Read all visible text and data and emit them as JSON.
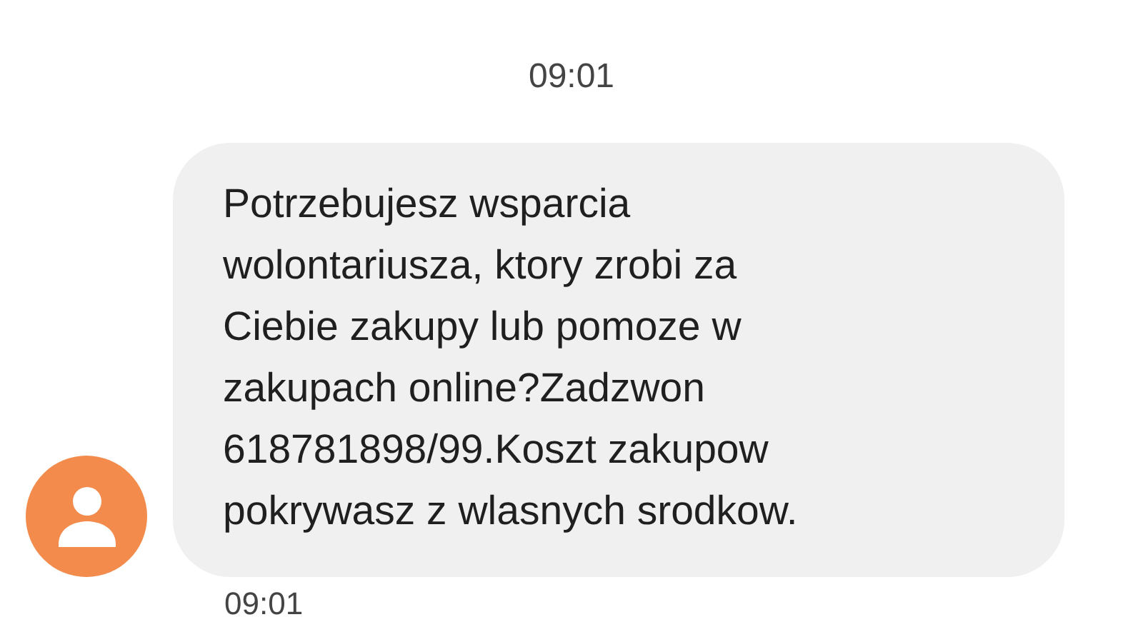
{
  "conversation_time": "09:01",
  "messages": [
    {
      "text": "Potrzebujesz wsparcia\nwolontariusza, ktory zrobi za\nCiebie zakupy lub pomoze w\nzakupach online?Zadzwon\n618781898/99.Koszt zakupow\npokrywasz z wlasnych srodkow.",
      "time": "09:01",
      "color": "#f28b4b"
    }
  ]
}
